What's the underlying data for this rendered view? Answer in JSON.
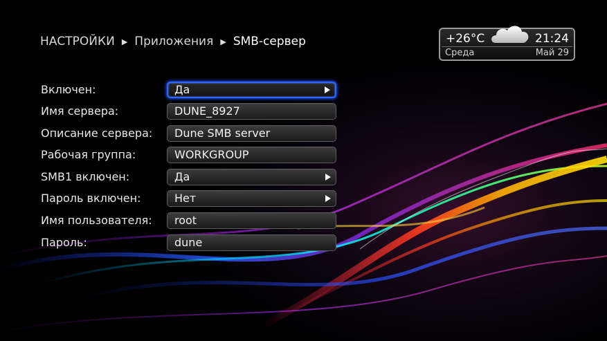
{
  "breadcrumb": {
    "items": [
      "НАСТРОЙКИ",
      "Приложения",
      "SMB-сервер"
    ]
  },
  "weather": {
    "temperature": "+26°C",
    "time": "21:24",
    "day": "Среда",
    "date": "Май 29",
    "icon": "cloud-icon"
  },
  "form": {
    "rows": [
      {
        "label": "Включен:",
        "value": "Да",
        "has_arrow": true,
        "focused": true
      },
      {
        "label": "Имя сервера:",
        "value": "DUNE_8927",
        "has_arrow": false
      },
      {
        "label": "Описание сервера:",
        "value": "Dune SMB server",
        "has_arrow": false
      },
      {
        "label": "Рабочая группа:",
        "value": "WORKGROUP",
        "has_arrow": false
      },
      {
        "label": "SMB1 включен:",
        "value": "Да",
        "has_arrow": true
      },
      {
        "label": "Пароль включен:",
        "value": "Нет",
        "has_arrow": true
      },
      {
        "label": "Имя пользователя:",
        "value": "root",
        "has_arrow": false
      },
      {
        "label": "Пароль:",
        "value": "dune",
        "has_arrow": false
      }
    ]
  },
  "colors": {
    "focus": "#2f64ff",
    "background": "#000000"
  }
}
